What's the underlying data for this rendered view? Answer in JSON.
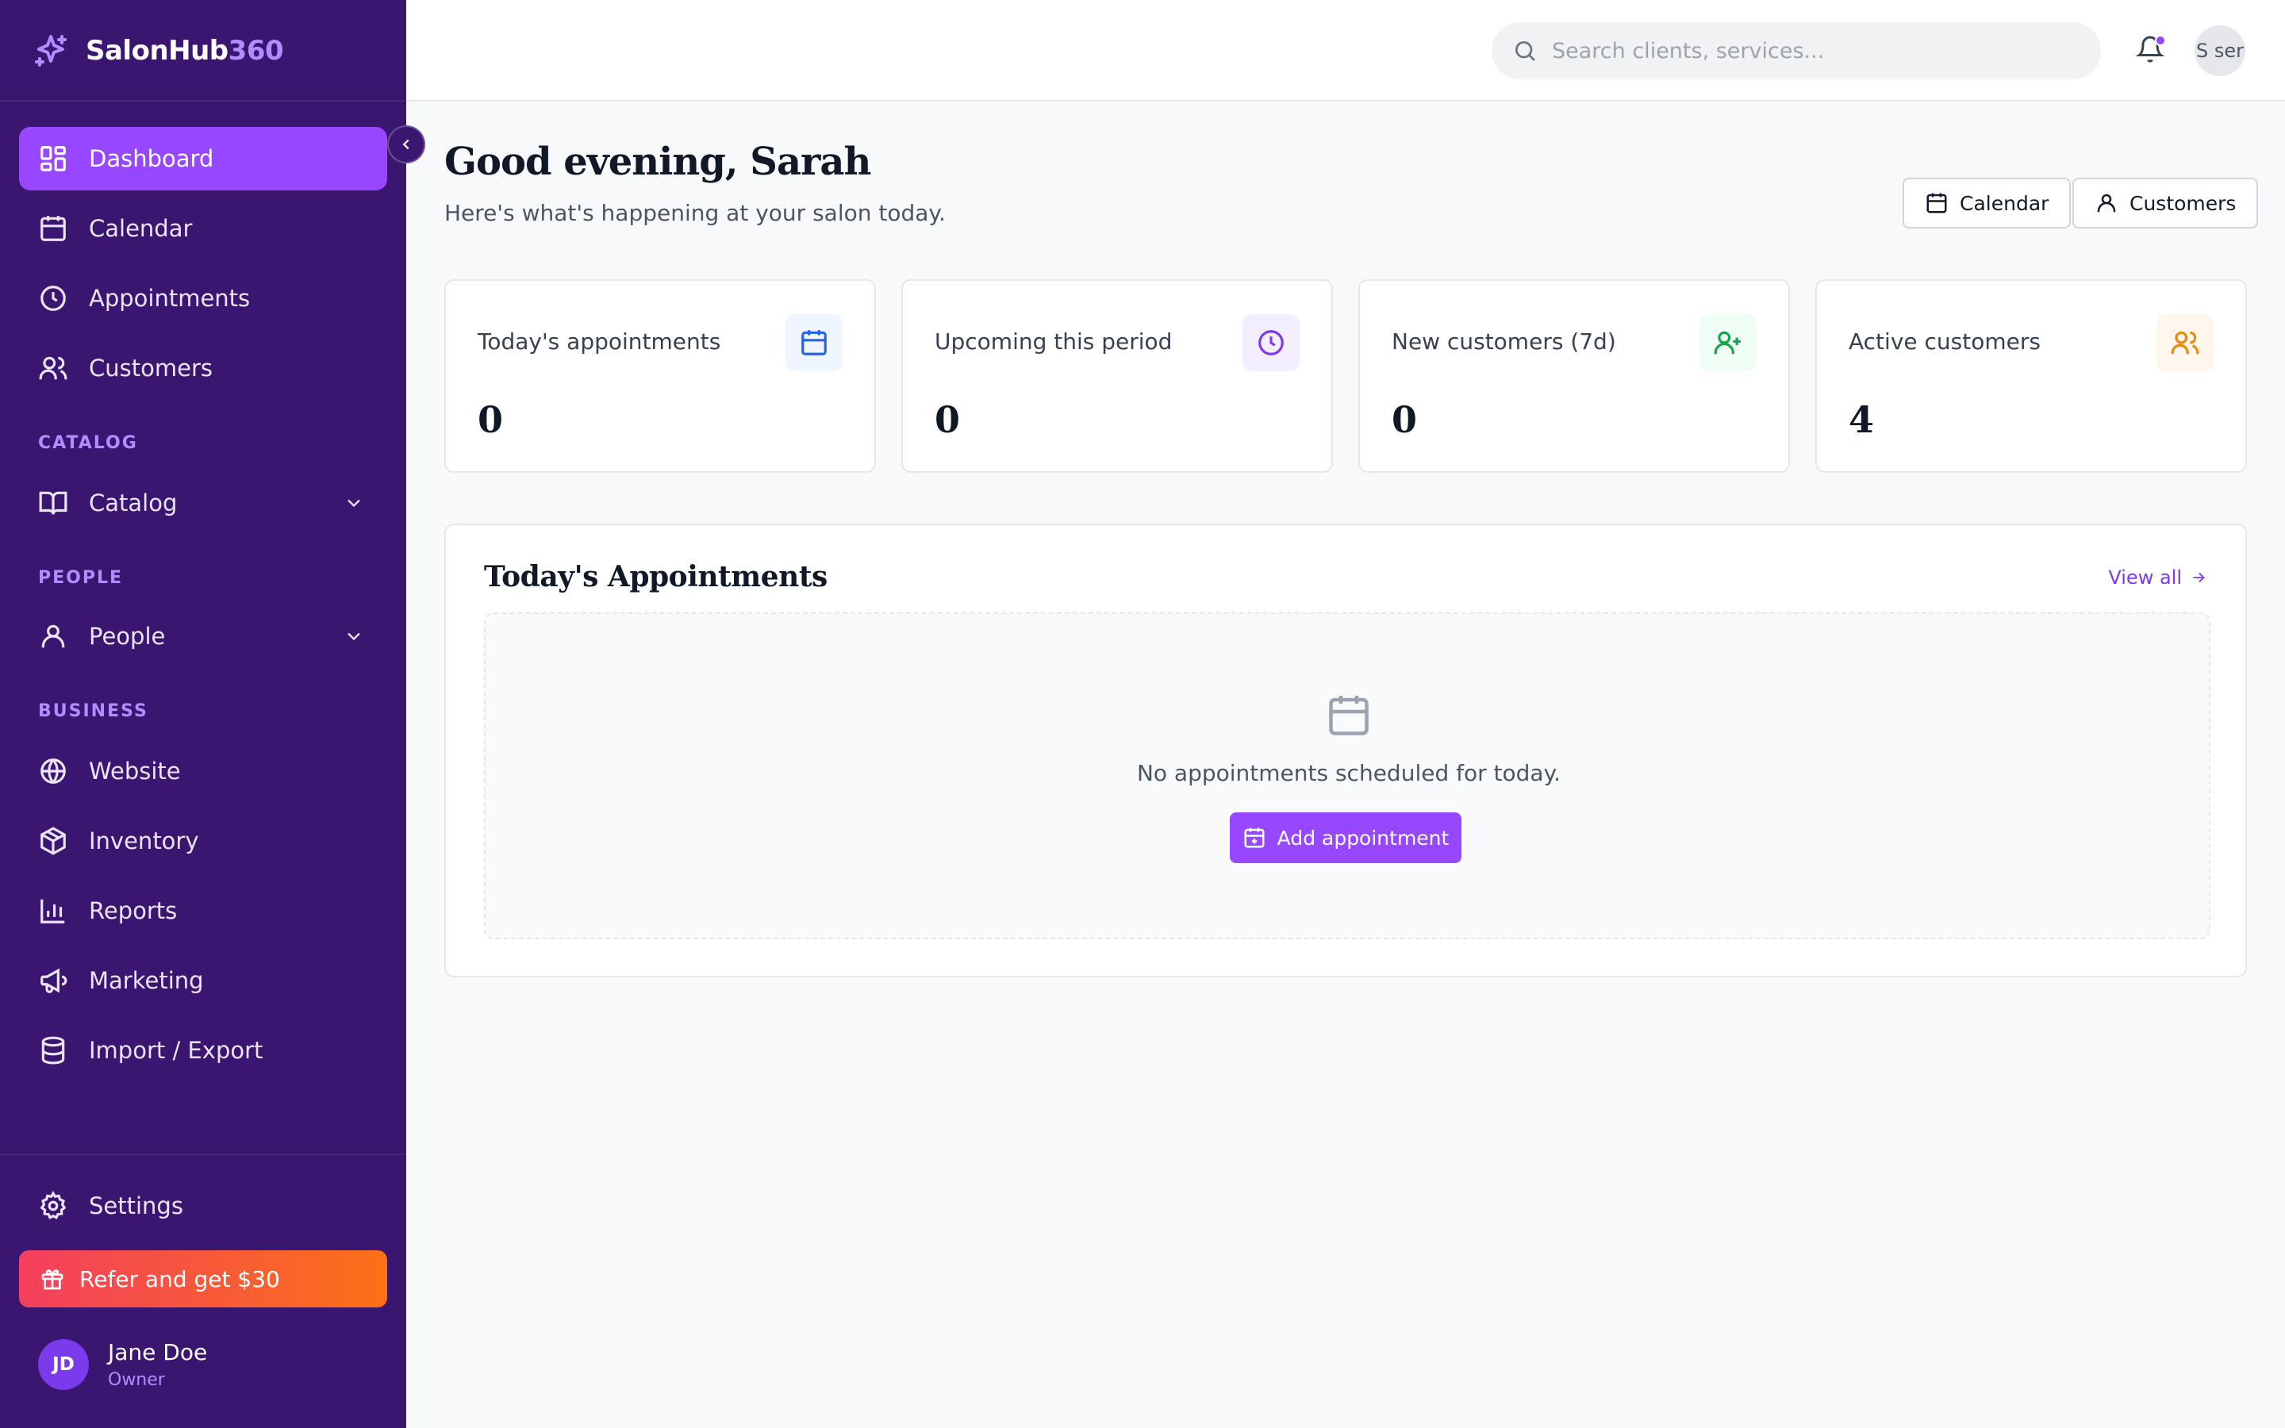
{
  "brand": {
    "name": "SalonHub",
    "accent": "360",
    "logo_icon": "sparkles-icon"
  },
  "sidebar": {
    "main_items": [
      {
        "label": "Dashboard",
        "icon": "dashboard-icon",
        "active": true
      },
      {
        "label": "Calendar",
        "icon": "calendar-icon"
      },
      {
        "label": "Appointments",
        "icon": "clock-icon"
      },
      {
        "label": "Customers",
        "icon": "users-icon"
      }
    ],
    "catalog_section": "CATALOG",
    "catalog_item": {
      "label": "Catalog",
      "icon": "book-open-icon"
    },
    "people_section": "PEOPLE",
    "people_item": {
      "label": "People",
      "icon": "user-icon"
    },
    "business_section": "BUSINESS",
    "business_items": [
      {
        "label": "Website",
        "icon": "globe-icon"
      },
      {
        "label": "Inventory",
        "icon": "package-icon"
      },
      {
        "label": "Reports",
        "icon": "bar-chart-icon"
      },
      {
        "label": "Marketing",
        "icon": "megaphone-icon"
      },
      {
        "label": "Import / Export",
        "icon": "database-icon"
      }
    ],
    "settings": {
      "label": "Settings",
      "icon": "gear-icon"
    },
    "refer": {
      "label": "Refer and get $30",
      "icon": "gift-icon"
    },
    "user": {
      "initials": "JD",
      "name": "Jane Doe",
      "role": "Owner"
    }
  },
  "topbar": {
    "search_placeholder": "Search clients, services...",
    "avatar_alt": "S ser"
  },
  "main": {
    "greeting": "Good evening, Sarah",
    "subtitle": "Here's what's happening at your salon today.",
    "calendar_button": "Calendar",
    "customers_button": "Customers",
    "stats": [
      {
        "label": "Today's appointments",
        "value": "0",
        "icon": "calendar-icon",
        "color": "#2563eb",
        "bg": "#eff6ff"
      },
      {
        "label": "Upcoming this period",
        "value": "0",
        "icon": "clock-icon",
        "color": "#7c3aed",
        "bg": "#f3eefe"
      },
      {
        "label": "New customers (7d)",
        "value": "0",
        "icon": "user-plus-icon",
        "color": "#16a34a",
        "bg": "#f0fdf4"
      },
      {
        "label": "Active customers",
        "value": "4",
        "icon": "users-icon",
        "color": "#ea8a0c",
        "bg": "#fff7ed"
      }
    ],
    "appointments_panel": {
      "title": "Today's Appointments",
      "view_all": "View all",
      "empty_text": "No appointments scheduled for today.",
      "add_button": "Add appointment"
    }
  },
  "colors": {
    "sidebar_bg": "#3a1670",
    "accent": "#9747ff",
    "accent_light": "#b48cff"
  }
}
